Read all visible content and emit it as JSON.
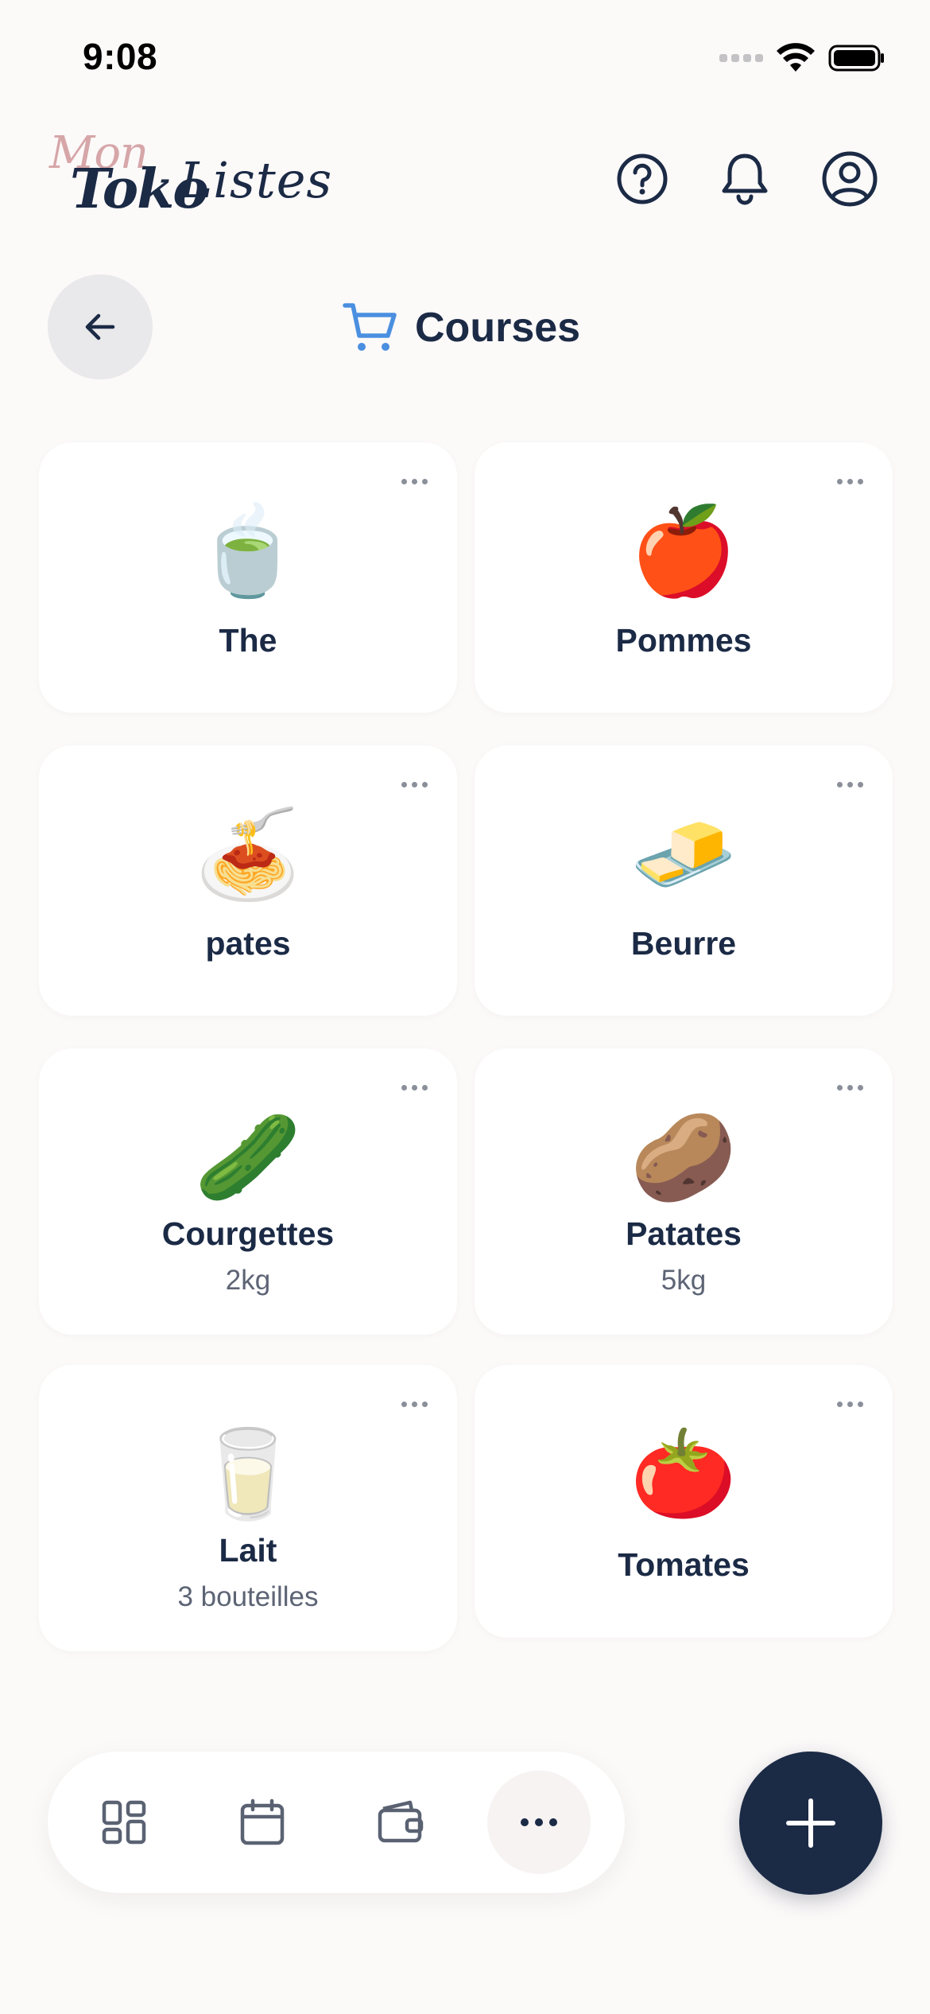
{
  "status_bar": {
    "time": "9:08"
  },
  "header": {
    "logo": {
      "line1": "Mon",
      "line2": "Toko",
      "line3": "Listes"
    }
  },
  "page": {
    "title": "Courses",
    "title_icon": "cart-icon"
  },
  "items": [
    {
      "emoji": "🍵",
      "name": "The",
      "qty": ""
    },
    {
      "emoji": "🍎",
      "name": "Pommes",
      "qty": ""
    },
    {
      "emoji": "🍝",
      "name": "pates",
      "qty": ""
    },
    {
      "emoji": "🧈",
      "name": "Beurre",
      "qty": ""
    },
    {
      "emoji": "🥒",
      "name": "Courgettes",
      "qty": "2kg"
    },
    {
      "emoji": "🥔",
      "name": "Patates",
      "qty": "5kg"
    },
    {
      "emoji": "🥛",
      "name": "Lait",
      "qty": "3 bouteilles"
    },
    {
      "emoji": "🍅",
      "name": "Tomates",
      "qty": ""
    }
  ],
  "bottom_nav": {
    "items": [
      "dashboard-icon",
      "calendar-icon",
      "wallet-icon",
      "more-icon"
    ],
    "active": "more-icon"
  },
  "colors": {
    "accent": "#1b2a45",
    "cart": "#4a8fe0",
    "logo_pink": "#d6a6a8",
    "background": "#fcf9f9"
  }
}
